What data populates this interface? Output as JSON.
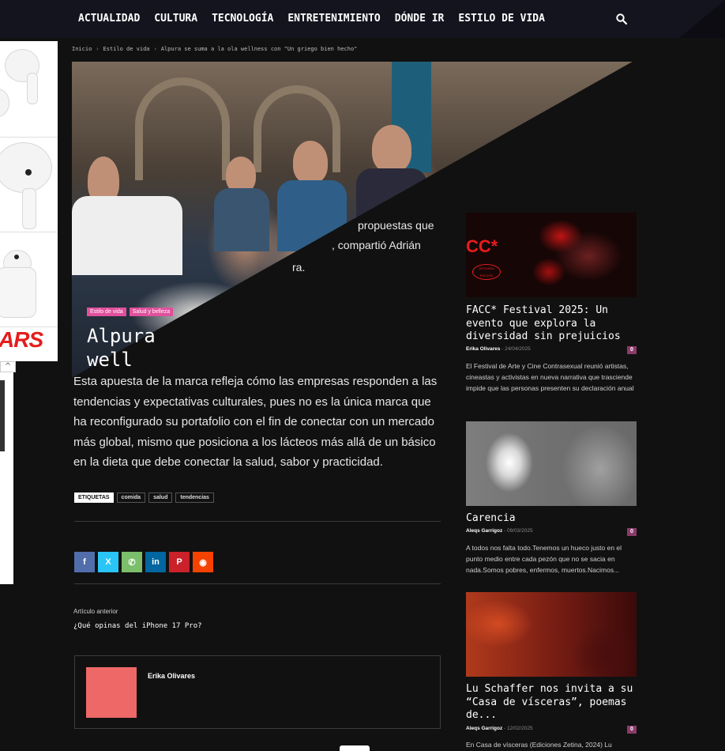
{
  "nav": {
    "items": [
      "ACTUALIDAD",
      "CULTURA",
      "TECNOLOGÍA",
      "ENTRETENIMIENTO",
      "DÓNDE IR",
      "ESTILO DE VIDA"
    ]
  },
  "breadcrumb": {
    "items": [
      "Inicio",
      "Estilo de vida",
      "Alpura se suma a la ola wellness con \"Un griego bien hecho\""
    ],
    "separator": "›"
  },
  "ad": {
    "brand": "ARS",
    "info": "ⓘ ⋮",
    "toggle": "^"
  },
  "hero": {
    "tags": [
      "Estilo de vida",
      "Salud y belleza"
    ],
    "title_line1": "Alpura",
    "title_line2": "well"
  },
  "fragments": {
    "line1": "propuestas que",
    "line2": ", compartió Adrián",
    "line3": "ra."
  },
  "article": {
    "paragraph": "Esta apuesta de la marca refleja cómo las empresas responden a las tendencias y expectativas culturales, pues no es la única marca que ha reconfigurado su portafolio con el fin de conectar con un mercado más global, mismo que posiciona a los lácteos más allá de un básico en la dieta que debe conectar la salud, sabor y practicidad.",
    "tags_label": "ETIQUETAS",
    "tags": [
      "comida",
      "salud",
      "tendencias"
    ],
    "prev_label": "Artículo anterior",
    "prev_title": "¿Qué opinas del iPhone 17 Pro?",
    "author_name": "Erika Olivares"
  },
  "share": [
    {
      "icon": "facebook-icon",
      "glyph": "f",
      "color": "#516eab"
    },
    {
      "icon": "x-icon",
      "glyph": "X",
      "color": "#29c5f6"
    },
    {
      "icon": "whatsapp-icon",
      "glyph": "✆",
      "color": "#7bbf6a"
    },
    {
      "icon": "linkedin-icon",
      "glyph": "in",
      "color": "#0266a0"
    },
    {
      "icon": "pinterest-icon",
      "glyph": "P",
      "color": "#ca212a"
    },
    {
      "icon": "reddit-icon",
      "glyph": "◉",
      "color": "#f54200"
    }
  ],
  "sidebar": {
    "cards": [
      {
        "title": "FACC* Festival 2025: Un evento que explora la diversidad sin prejuicios",
        "author": "Erika Olivares",
        "date": "24/04/2025",
        "count": "0",
        "excerpt": "El Festival de Arte y Cine Contrasexual reunió artistas, cineastas y activistas en nueva narrativa que trasciende impide que las personas presenten su declaración anual",
        "img_logo": "CC*",
        "img_seal": "SEGUNDA EDICIÓN"
      },
      {
        "title": "Carencia",
        "author": "Aleqs Garrigoz",
        "date": "09/03/2025",
        "count": "0",
        "excerpt": "A todos nos falta todo.Tenemos un hueco justo en el punto medio entre cada pezón que no se sacia en nada.Somos pobres, enfermos, muertos.Nacimos..."
      },
      {
        "title": "Lu Schaffer nos invita a su “Casa de vísceras”, poemas de...",
        "author": "Aleqs Garrigoz",
        "date": "12/02/2025",
        "count": "0",
        "excerpt": "En Casa de vísceras (Ediciones Zetina, 2024) Lu"
      }
    ]
  }
}
